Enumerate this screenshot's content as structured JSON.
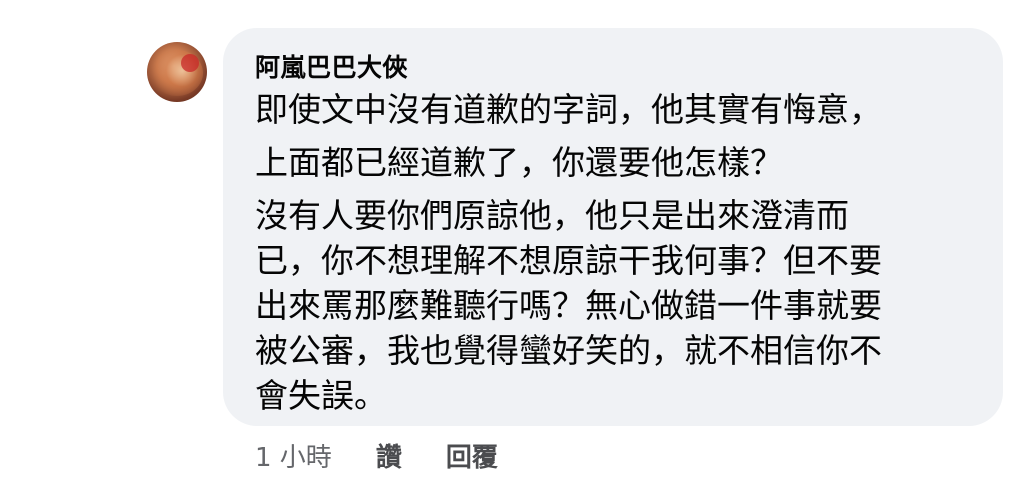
{
  "comment": {
    "author": "阿嵐巴巴大俠",
    "lines": [
      "即使文中沒有道歉的字詞，他其實有悔意，",
      "上面都已經道歉了，你還要他怎樣？",
      "沒有人要你們原諒他，他只是出來澄清而",
      "已，你不想理解不想原諒干我何事？但不要",
      "出來罵那麼難聽行嗎？無心做錯一件事就要",
      "被公審，我也覺得蠻好笑的，就不相信你不",
      "會失誤。"
    ],
    "timestamp": "1 小時",
    "like_label": "讚",
    "reply_label": "回覆"
  },
  "colors": {
    "bubble_bg": "#f0f2f5",
    "text": "#050505",
    "secondary_text": "#65676b"
  }
}
